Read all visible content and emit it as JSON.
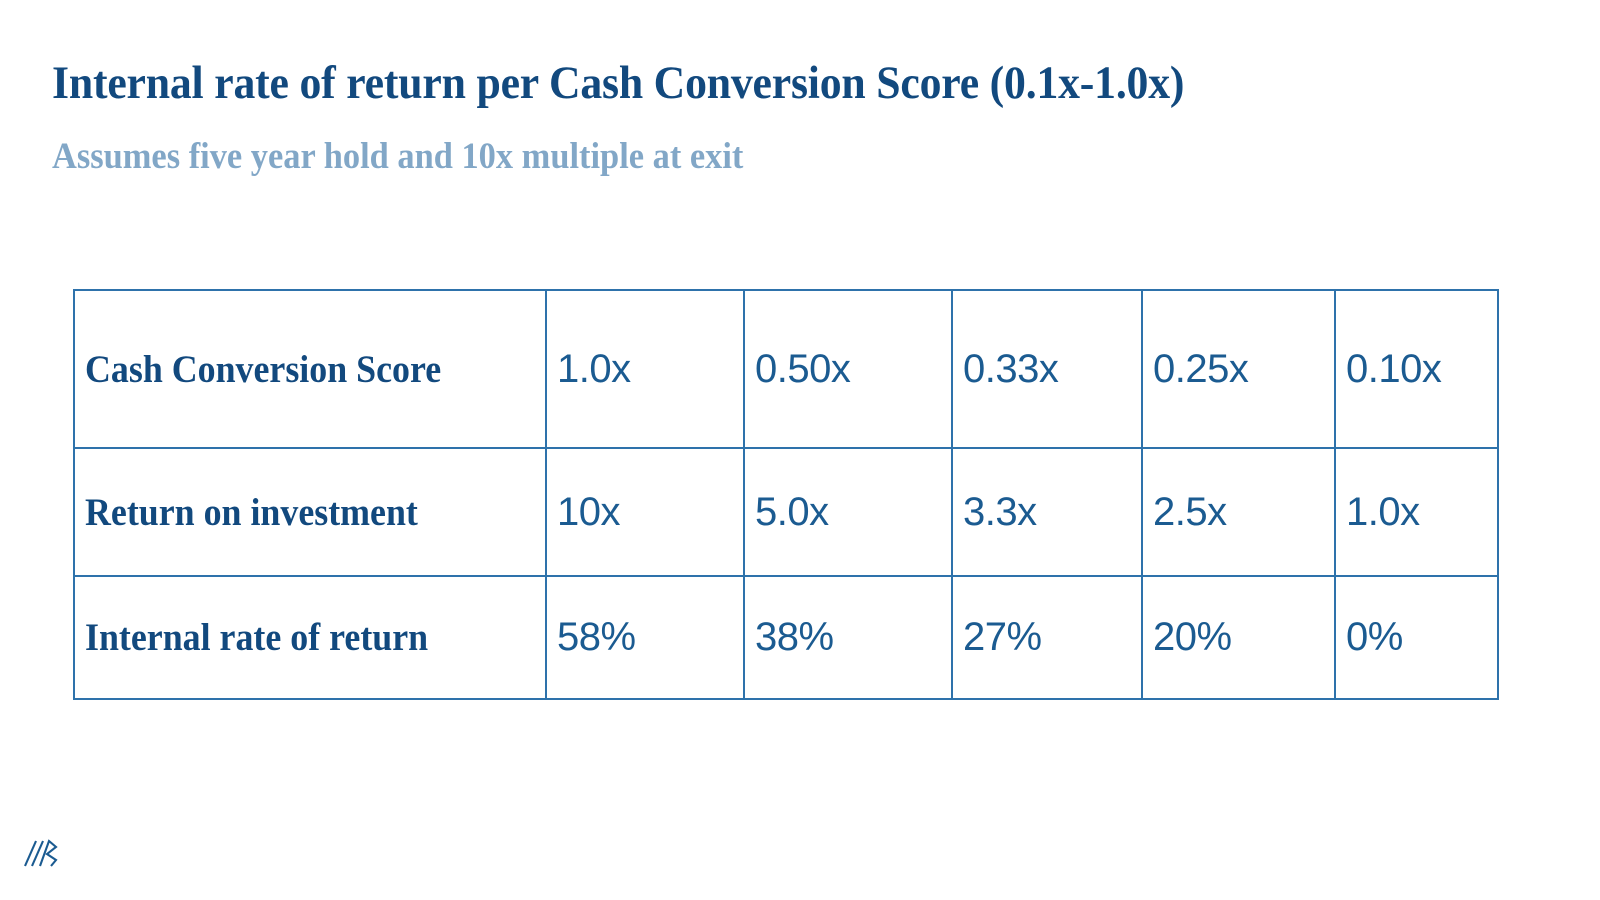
{
  "header": {
    "title": "Internal rate of return per Cash Conversion Score (0.1x-1.0x)",
    "subtitle": "Assumes five year hold and 10x multiple at exit"
  },
  "colors": {
    "title_blue": "#12497E",
    "subtitle_blue": "#82A7C7",
    "border_blue": "#2E72AB",
    "value_blue": "#1B5B91",
    "background": "#FFFFFF"
  },
  "chart_data": {
    "type": "table",
    "title": "Internal rate of return per Cash Conversion Score (0.1x-1.0x)",
    "subtitle": "Assumes five year hold and 10x multiple at exit",
    "row_labels": [
      "Cash Conversion Score",
      "Return on investment",
      "Internal rate of return"
    ],
    "rows": [
      {
        "label": "Cash Conversion Score",
        "values": [
          "1.0x",
          "0.50x",
          "0.33x",
          "0.25x",
          "0.10x"
        ]
      },
      {
        "label": "Return on investment",
        "values": [
          "10x",
          "5.0x",
          "3.3x",
          "2.5x",
          "1.0x"
        ]
      },
      {
        "label": "Internal rate of return",
        "values": [
          "58%",
          "38%",
          "27%",
          "20%",
          "0%"
        ]
      }
    ],
    "cash_conversion_score": [
      1.0,
      0.5,
      0.33,
      0.25,
      0.1
    ],
    "return_on_investment": [
      10,
      5.0,
      3.3,
      2.5,
      1.0
    ],
    "internal_rate_of_return_pct": [
      58,
      38,
      27,
      20,
      0
    ],
    "xlabel": "Cash Conversion Score",
    "ylabel": "Internal rate of return",
    "grid": true,
    "legend": "none"
  },
  "footer": {
    "logo_name": "company-logo-mark"
  }
}
